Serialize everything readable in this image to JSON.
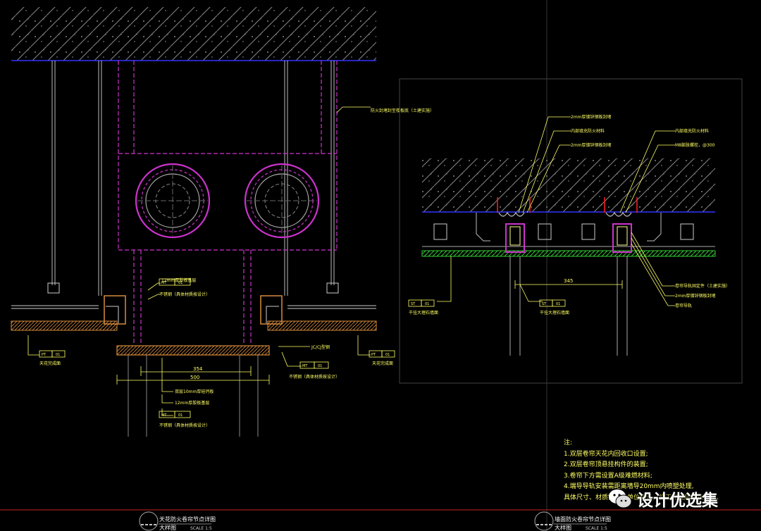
{
  "drawing_left": {
    "callouts": {
      "fire_seal": "防火封堵封至楼板底（土建实施）",
      "plywood_12": "12mm厚胶板基层",
      "mt01_top_code": "MT",
      "mt01_top_num": "01",
      "stainless_top": "不锈钢（具体材质按设计）",
      "jc": "JC/CJ型钢",
      "mt01_right_code": "MT",
      "mt01_right_num": "01",
      "stainless_right": "不锈钢（具体材质按设计）",
      "pt01_left_code": "PT",
      "pt01_left_num": "01",
      "ceiling_left": "天花完成面",
      "pt01_right_code": "PT",
      "pt01_right_num": "01",
      "ceiling_right": "天花完成面",
      "double_board": "双层10mm厚硅钙板",
      "plywood_12_b": "12mm厚胶板基层",
      "mt01_bottom_code": "MT",
      "mt01_bottom_num": "01",
      "stainless_bottom": "不锈钢（具体材质按设计）"
    },
    "dims": {
      "inner": "354",
      "outer": "500"
    },
    "title": {
      "name": "天花防火卷帘节点详图",
      "sub": "大样图",
      "scale": "SCALE  1:5"
    }
  },
  "drawing_right": {
    "callouts": {
      "steel_2mm_a": "2mm厚镀锌钢板封堵",
      "fire_fill_a": "内部填充防火材料",
      "steel_2mm_b": "2mm厚镀锌钢板封堵",
      "fire_fill_b": "内部填充防火材料",
      "bolt": "M8膨胀螺栓，@300",
      "track_install": "卷帘导轨固定件（土建实施）",
      "steel_2mm_c": "2mm厚镀锌钢板封堵",
      "track": "卷帘导轨",
      "st01_left_code": "ST",
      "st01_left_num": "01",
      "stone_left": "干挂大理石墙面",
      "st01_right_code": "ST",
      "st01_right_num": "01",
      "stone_right": "干挂大理石墙面"
    },
    "dims": {
      "width": "345"
    },
    "title": {
      "name": "墙面防火卷帘节点详图",
      "sub": "大样图",
      "scale": "SCALE  1:5"
    }
  },
  "notes": {
    "heading": "注:",
    "lines": [
      "1.双层卷帘天花内回收口设置;",
      "2.双层卷帘顶悬挂构件的装置;",
      "3.卷帘下方需设置A级难燃材料;",
      "4.端导导轨安装需距离墙导20mm内喷塑处理,",
      "具体尺寸、材质需设计单位确认，施工完成后需认为准。"
    ]
  },
  "watermark": {
    "text": "设计优选集"
  },
  "colors": {
    "background": "#000000",
    "text_yellow": "#ffff66",
    "magenta": "#cc33cc",
    "hatch_grey": "#9a9a9a",
    "blue_line": "#3333ff",
    "orange": "#d98b3a",
    "green": "#33cc33",
    "red": "#ff2020"
  }
}
